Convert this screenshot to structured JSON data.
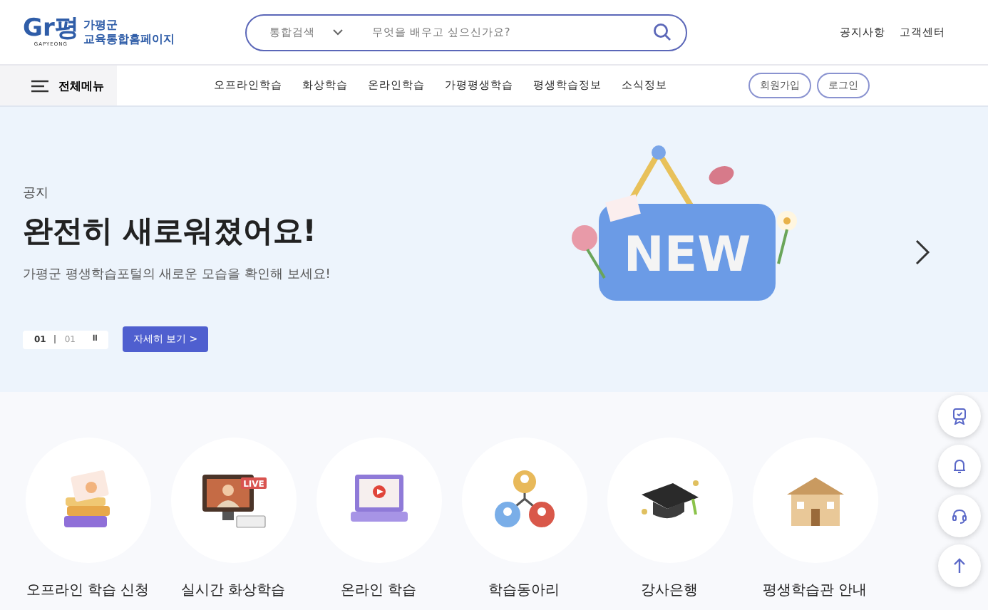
{
  "logo": {
    "mark": "Gr평",
    "mark_sub": "GAPYEONG",
    "line1": "가평군",
    "line2": "교육통합홈페이지"
  },
  "search": {
    "scope": "통합검색",
    "placeholder": "무엇을 배우고 싶으신가요?"
  },
  "top_links": [
    "공지사항",
    "고객센터"
  ],
  "nav": {
    "all_menu": "전체메뉴",
    "items": [
      "오프라인학습",
      "화상학습",
      "온라인학습",
      "가평평생학습",
      "평생학습정보",
      "소식정보"
    ],
    "auth": [
      "회원가입",
      "로그인"
    ]
  },
  "hero": {
    "tag": "공지",
    "title": "완전히 새로워졌어요!",
    "subtitle": "가평군 평생학습포털의 새로운 모습을 확인해 보세요!",
    "counter_current": "01",
    "counter_total": "01",
    "pause": "II",
    "more_button": "자세히 보기  >",
    "sign_text": "NEW"
  },
  "quick_menu": [
    {
      "kind": "books",
      "label": "오프라인 학습 신청"
    },
    {
      "kind": "live",
      "label": "실시간 화상학습",
      "badge": "LIVE"
    },
    {
      "kind": "laptop",
      "label": "온라인 학습"
    },
    {
      "kind": "people",
      "label": "학습동아리"
    },
    {
      "kind": "cap",
      "label": "강사은행"
    },
    {
      "kind": "building",
      "label": "평생학습관 안내"
    }
  ],
  "side_buttons": [
    {
      "kind": "badge"
    },
    {
      "kind": "bell"
    },
    {
      "kind": "headset"
    },
    {
      "kind": "top"
    }
  ]
}
